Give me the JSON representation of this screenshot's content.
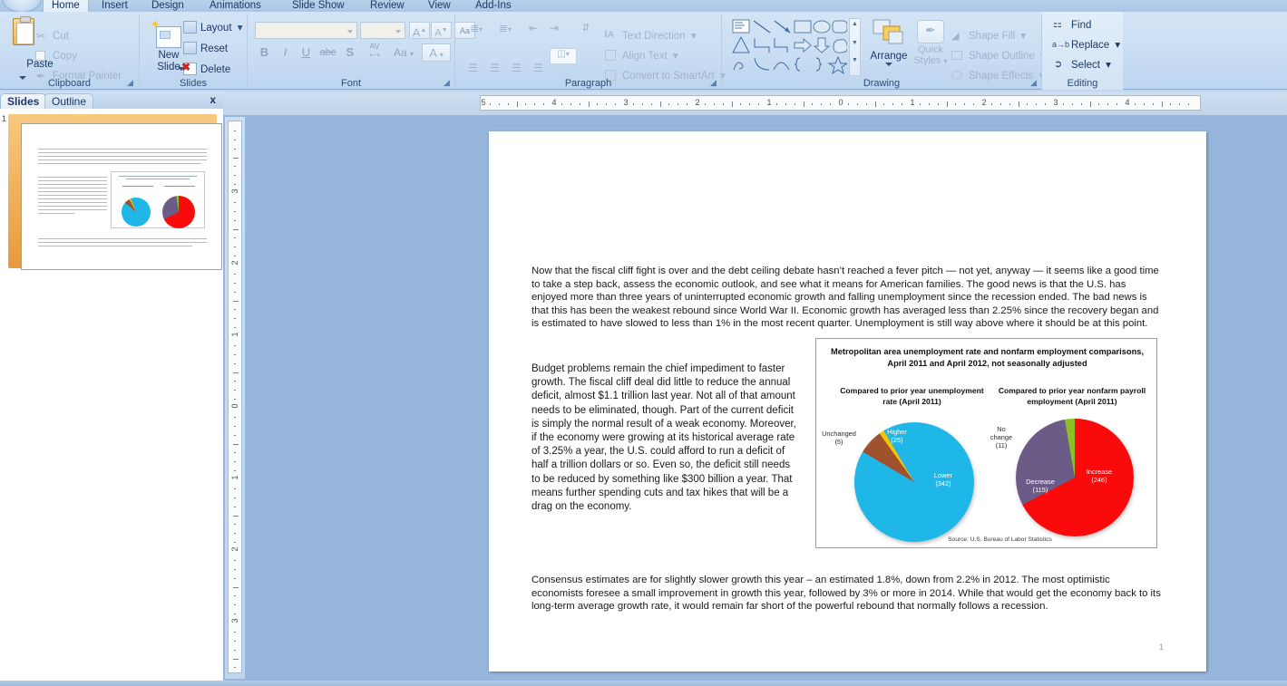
{
  "app": {
    "orb_icon": "office-orb-icon",
    "tabs": [
      {
        "label": "Home",
        "active": true
      },
      {
        "label": "Insert",
        "active": false
      },
      {
        "label": "Design",
        "active": false
      },
      {
        "label": "Animations",
        "active": false
      },
      {
        "label": "Slide Show",
        "active": false
      },
      {
        "label": "Review",
        "active": false
      },
      {
        "label": "View",
        "active": false
      },
      {
        "label": "Add-Ins",
        "active": false
      }
    ]
  },
  "ribbon": {
    "clipboard": {
      "label": "Clipboard",
      "paste": "Paste",
      "cut": "Cut",
      "copy": "Copy",
      "format_painter": "Format Painter",
      "dialog_launcher": "◢"
    },
    "slides": {
      "label": "Slides",
      "new_slide_line1": "New",
      "new_slide_line2": "Slide",
      "layout": "Layout",
      "reset": "Reset",
      "delete": "Delete"
    },
    "font": {
      "label": "Font",
      "font_name_value": "",
      "font_name_placeholder": "",
      "font_size_value": "",
      "grow_font": "A",
      "shrink_font": "A",
      "clear_formatting": "Aa",
      "bold": "B",
      "italic": "I",
      "underline": "U",
      "strikethrough": "abc",
      "shadow": "S",
      "character_spacing": "AV",
      "change_case": "Aa",
      "font_color": "A",
      "dialog_launcher": "◢"
    },
    "paragraph": {
      "label": "Paragraph",
      "text_direction": "Text Direction",
      "align_text": "Align Text",
      "convert_to_smartart": "Convert to SmartArt",
      "dialog_launcher": "◢"
    },
    "drawing": {
      "label": "Drawing",
      "arrange": "Arrange",
      "quick_styles_line1": "Quick",
      "quick_styles_line2": "Styles",
      "shape_fill": "Shape Fill",
      "shape_outline": "Shape Outline",
      "shape_effects": "Shape Effects",
      "dialog_launcher": "◢"
    },
    "editing": {
      "label": "Editing",
      "find": "Find",
      "replace": "Replace",
      "select": "Select"
    }
  },
  "left_pane": {
    "tabs": [
      {
        "label": "Slides",
        "active": true
      },
      {
        "label": "Outline",
        "active": false
      }
    ],
    "close_label": "x",
    "thumbnail_number": "1"
  },
  "rulers": {
    "horizontal_numbers": [
      "5",
      "4",
      "3",
      "2",
      "1",
      "0",
      "1",
      "2",
      "3",
      "4"
    ],
    "vertical_numbers": [
      "3",
      "2",
      "1",
      "0",
      "1",
      "2",
      "3"
    ]
  },
  "slide": {
    "page_number": "1",
    "paragraph1": "Now that the fiscal cliff fight is over and the debt ceiling debate hasn’t reached a fever pitch — not yet, anyway — it seems like a good time to take a step back, assess the economic outlook, and see what it means for American families. The good news is that the U.S. has enjoyed more than three years of uninterrupted economic growth and falling unemployment since the recession ended. The bad news is that this has been the weakest rebound since World War II. Economic growth has averaged less than 2.25% since the recovery began and is estimated to have slowed to less than 1% in the most recent quarter. Unemployment is still way above where it should be at this point.",
    "paragraph2": "Budget problems remain the chief impediment to faster growth. The fiscal cliff deal did little to reduce the annual deficit, almost $1.1 trillion last year. Not all of that amount needs to be eliminated, though. Part of the current deficit is simply the normal result of a weak economy. Moreover, if the economy were growing at its historical average rate of 3.25% a year, the U.S. could afford to run a deficit of half a trillion dollars or so. Even so, the deficit still needs to be reduced by something like $300 billion a year. That means further spending cuts and tax hikes that will be a drag on the economy.",
    "paragraph3": "Consensus estimates are for slightly slower growth this year – an estimated 1.8%, down from 2.2% in 2012. The most optimistic economists foresee a small improvement in growth this year, followed by 3% or more in 2014. While that would get the economy back to its long-term average growth rate, it would remain far short of the powerful rebound that normally follows a recession."
  },
  "chart_data": [
    {
      "type": "pie",
      "title": "Metropolitan area unemployment rate and nonfarm employment comparisons, April 2011 and April 2012, not seasonally adjusted",
      "subtitle": "Compared to prior year unemployment rate (April 2011)",
      "source": "Source: U.S. Bureau of Labor Statistics",
      "labels": [
        "Lower",
        "Unchanged",
        "Higher"
      ],
      "values": [
        342,
        25,
        5
      ],
      "slices": [
        {
          "label": "Lower",
          "value": 342,
          "color": "#1fb6e8",
          "label_position": "inside",
          "label_color": "#ffffff"
        },
        {
          "label": "Higher",
          "value": 25,
          "color": "#a0522d",
          "label_position": "inside",
          "label_color": "#ffffff"
        },
        {
          "label": "Unchanged",
          "value": 5,
          "color": "#f5c400",
          "label_position": "outside",
          "label_color": "#2b2b2b"
        }
      ],
      "legend": false,
      "grid": false
    },
    {
      "type": "pie",
      "title": "Metropolitan area unemployment rate and nonfarm employment comparisons, April 2011 and April 2012, not seasonally adjusted",
      "subtitle": "Compared to prior year nonfarm payroll employment (April 2011)",
      "source": "Source: U.S. Bureau of Labor Statistics",
      "labels": [
        "Increase",
        "Decrease",
        "No change"
      ],
      "values": [
        246,
        115,
        11
      ],
      "slices": [
        {
          "label": "Increase",
          "value": 246,
          "color": "#fa0a0a",
          "label_position": "inside",
          "label_color": "#ffffff"
        },
        {
          "label": "Decrease",
          "value": 115,
          "color": "#6b5b87",
          "label_position": "inside",
          "label_color": "#ffffff"
        },
        {
          "label": "No change",
          "value": 11,
          "color": "#8cbf26",
          "label_position": "outside",
          "label_color": "#2b2b2b"
        }
      ],
      "legend": false,
      "grid": false
    }
  ],
  "chart_labels": {
    "title": "Metropolitan area unemployment rate and nonfarm employment comparisons, April 2011 and April 2012, not seasonally adjusted",
    "pie1_title": "Compared to prior year unemployment rate (April 2011)",
    "pie2_title": "Compared to prior year nonfarm payroll employment (April 2011)",
    "source": "Source: U.S. Bureau of Labor Statistics",
    "pie1_lower": "Lower\n(342)",
    "pie1_lower_l1": "Lower",
    "pie1_lower_l2": "(342)",
    "pie1_higher_l1": "Higher",
    "pie1_higher_l2": "(25)",
    "pie1_unchanged_l1": "Unchanged",
    "pie1_unchanged_l2": "(5)",
    "pie2_increase_l1": "Increase",
    "pie2_increase_l2": "(246)",
    "pie2_decrease_l1": "Decrease",
    "pie2_decrease_l2": "(115)",
    "pie2_nochange_l1": "No",
    "pie2_nochange_l2": "change",
    "pie2_nochange_l3": "(11)"
  },
  "colors": {
    "cyan": "#1fb6e8",
    "brown": "#a0522d",
    "yellow": "#f5c400",
    "red": "#fa0a0a",
    "purple": "#6b5b87",
    "green": "#8cbf26",
    "ribbon_text": "#1f3864"
  }
}
